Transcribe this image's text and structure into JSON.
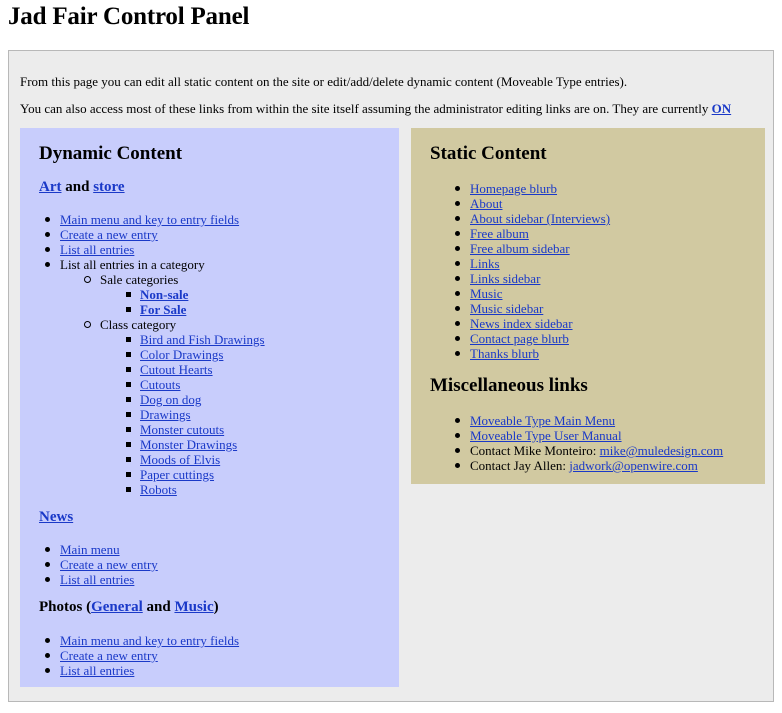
{
  "page_title": "Jad Fair Control Panel",
  "intro": {
    "line1": "From this page you can edit all static content on the site or edit/add/delete dynamic content (Moveable Type entries).",
    "line2_prefix": "You can also access most of these links from within the site itself assuming the administrator editing links are on. They are currently ",
    "line2_link": "ON"
  },
  "dynamic": {
    "title": "Dynamic Content",
    "art_heading": {
      "art": "Art",
      "and": " and ",
      "store": "store"
    },
    "art_items": [
      {
        "label": "Main menu and key to entry fields",
        "link": true,
        "level": 1
      },
      {
        "label": "Create a new entry",
        "link": true,
        "level": 1
      },
      {
        "label": "List all entries",
        "link": true,
        "level": 1
      },
      {
        "label": "List all entries in a category",
        "link": false,
        "level": 1
      },
      {
        "label": "Sale categories",
        "link": false,
        "level": 2
      },
      {
        "label": "Non-sale",
        "link": true,
        "bold": true,
        "level": 3
      },
      {
        "label": "For Sale",
        "link": true,
        "bold": true,
        "level": 3
      },
      {
        "label": "Class category",
        "link": false,
        "level": 2
      },
      {
        "label": "Bird and Fish Drawings",
        "link": true,
        "level": 3
      },
      {
        "label": "Color Drawings",
        "link": true,
        "level": 3
      },
      {
        "label": "Cutout Hearts",
        "link": true,
        "level": 3
      },
      {
        "label": "Cutouts",
        "link": true,
        "level": 3
      },
      {
        "label": "Dog on dog",
        "link": true,
        "level": 3
      },
      {
        "label": "Drawings",
        "link": true,
        "level": 3
      },
      {
        "label": "Monster cutouts",
        "link": true,
        "level": 3
      },
      {
        "label": "Monster Drawings",
        "link": true,
        "level": 3
      },
      {
        "label": "Moods of Elvis",
        "link": true,
        "level": 3
      },
      {
        "label": "Paper cuttings",
        "link": true,
        "level": 3
      },
      {
        "label": "Robots",
        "link": true,
        "level": 3
      }
    ],
    "news_heading": "News",
    "news_items": [
      {
        "label": "Main menu",
        "link": true,
        "level": 1
      },
      {
        "label": "Create a new entry",
        "link": true,
        "level": 1
      },
      {
        "label": "List all entries",
        "link": true,
        "level": 1
      }
    ],
    "photos_heading": {
      "prefix": "Photos (",
      "general": "General",
      "and": " and ",
      "music": "Music",
      "suffix": ")"
    },
    "photos_items": [
      {
        "label": "Main menu and key to entry fields",
        "link": true,
        "level": 1
      },
      {
        "label": "Create a new entry",
        "link": true,
        "level": 1
      },
      {
        "label": "List all entries",
        "link": true,
        "level": 1
      }
    ]
  },
  "static": {
    "title": "Static Content",
    "items": [
      {
        "label": "Homepage blurb",
        "link": true,
        "level": 1
      },
      {
        "label": "About",
        "link": true,
        "level": 1
      },
      {
        "label": "About sidebar (Interviews)",
        "link": true,
        "level": 1
      },
      {
        "label": "Free album",
        "link": true,
        "level": 1
      },
      {
        "label": "Free album sidebar",
        "link": true,
        "level": 1
      },
      {
        "label": "Links",
        "link": true,
        "level": 1
      },
      {
        "label": "Links sidebar",
        "link": true,
        "level": 1
      },
      {
        "label": "Music",
        "link": true,
        "level": 1
      },
      {
        "label": "Music sidebar",
        "link": true,
        "level": 1
      },
      {
        "label": "News index sidebar",
        "link": true,
        "level": 1
      },
      {
        "label": "Contact page blurb",
        "link": true,
        "level": 1
      },
      {
        "label": "Thanks blurb",
        "link": true,
        "level": 1
      }
    ],
    "misc_title": "Miscellaneous links",
    "misc_items": [
      {
        "label": "Moveable Type Main Menu",
        "link": true,
        "level": 1
      },
      {
        "label": "Moveable Type User Manual",
        "link": true,
        "level": 1
      },
      {
        "prefix": "Contact Mike Monteiro: ",
        "label": "mike@muledesign.com",
        "link": true,
        "level": 1
      },
      {
        "prefix": "Contact Jay Allen: ",
        "label": "jadwork@openwire.com",
        "link": true,
        "level": 1
      }
    ]
  },
  "colors": {
    "link": "#1a39c8",
    "dynamic_bg": "#c8cdfc",
    "static_bg": "#d1c9a1",
    "panel_bg": "#ececec"
  }
}
